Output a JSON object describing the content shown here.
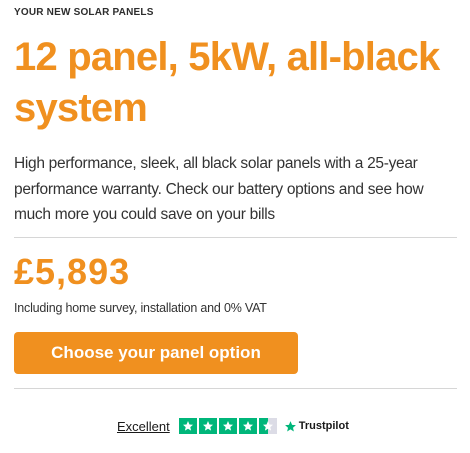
{
  "product": {
    "eyebrow": "YOUR NEW SOLAR PANELS",
    "title": "12 panel, 5kW, all-black system",
    "description": "High performance, sleek, all black solar panels with a 25-year performance warranty. Check our battery options and see how much more you could save on your bills",
    "price": "£5,893",
    "price_note": "Including home survey, installation and 0% VAT",
    "cta_label": "Choose your panel option"
  },
  "trustpilot": {
    "label": "Excellent",
    "brand": "Trustpilot",
    "star_rating": 4.5,
    "star_color": "#00b67a"
  },
  "colors": {
    "accent": "#f0901f"
  }
}
